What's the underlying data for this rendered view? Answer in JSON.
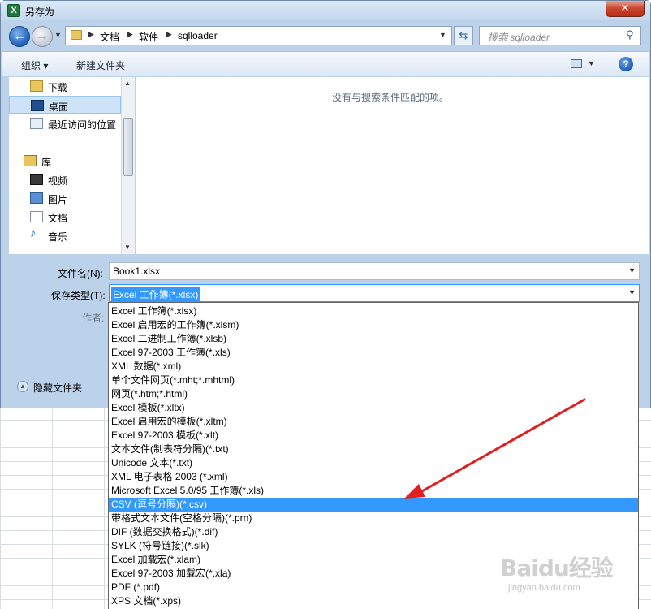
{
  "window": {
    "title": "另存为",
    "close_label": "✕"
  },
  "address": {
    "crumbs": [
      "文档",
      "软件",
      "sqlloader"
    ],
    "search_placeholder": "搜索 sqlloader"
  },
  "toolbar": {
    "organize": "组织 ▾",
    "new_folder": "新建文件夹"
  },
  "nav": {
    "items": [
      {
        "label": "下载",
        "icon": "download-folder-icon"
      },
      {
        "label": "桌面",
        "icon": "desktop-icon",
        "selected": true
      },
      {
        "label": "最近访问的位置",
        "icon": "recent-places-icon"
      },
      {
        "label": "库",
        "icon": "library-icon"
      },
      {
        "label": "视频",
        "icon": "video-icon"
      },
      {
        "label": "图片",
        "icon": "pictures-icon"
      },
      {
        "label": "文档",
        "icon": "documents-icon"
      },
      {
        "label": "音乐",
        "icon": "music-icon"
      }
    ]
  },
  "filepane": {
    "empty_message": "没有与搜索条件匹配的项。"
  },
  "form": {
    "filename_label": "文件名(N):",
    "filename_value": "Book1.xlsx",
    "savetype_label": "保存类型(T):",
    "savetype_value": "Excel 工作簿(*.xlsx)",
    "author_label": "作者:",
    "hide_folders": "隐藏文件夹"
  },
  "savetype_options": [
    "Excel 工作簿(*.xlsx)",
    "Excel 启用宏的工作簿(*.xlsm)",
    "Excel 二进制工作簿(*.xlsb)",
    "Excel 97-2003 工作簿(*.xls)",
    "XML 数据(*.xml)",
    "单个文件网页(*.mht;*.mhtml)",
    "网页(*.htm;*.html)",
    "Excel 模板(*.xltx)",
    "Excel 启用宏的模板(*.xltm)",
    "Excel 97-2003 模板(*.xlt)",
    "文本文件(制表符分隔)(*.txt)",
    "Unicode 文本(*.txt)",
    "XML 电子表格 2003 (*.xml)",
    "Microsoft Excel 5.0/95 工作簿(*.xls)",
    "CSV (逗号分隔)(*.csv)",
    "带格式文本文件(空格分隔)(*.prn)",
    "DIF (数据交换格式)(*.dif)",
    "SYLK (符号链接)(*.slk)",
    "Excel 加载宏(*.xlam)",
    "Excel 97-2003 加载宏(*.xla)",
    "PDF (*.pdf)",
    "XPS 文档(*.xps)"
  ],
  "highlighted_option": "CSV (逗号分隔)(*.csv)",
  "watermark": {
    "logo": "Baidu经验",
    "url": "jingyan.baidu.com"
  },
  "colors": {
    "highlight": "#3399ff",
    "annotation_arrow": "#e02020",
    "chrome": "#bcd2ea"
  }
}
